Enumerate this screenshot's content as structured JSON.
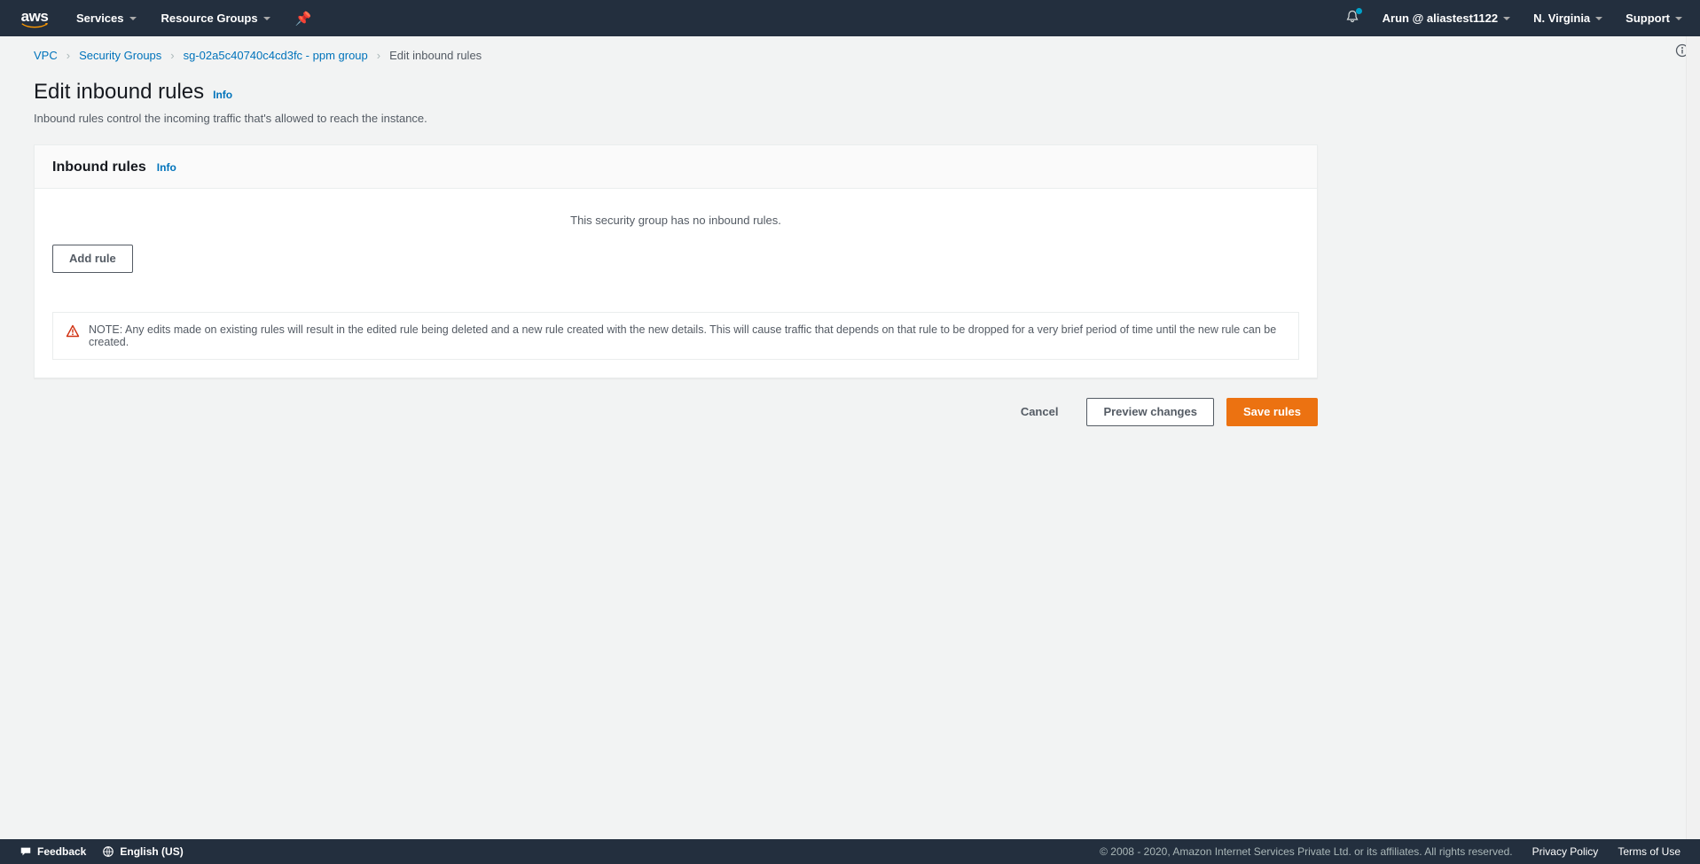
{
  "topnav": {
    "services": "Services",
    "resource_groups": "Resource Groups",
    "user": "Arun @ aliastest1122",
    "region": "N. Virginia",
    "support": "Support"
  },
  "breadcrumbs": {
    "items": [
      {
        "label": "VPC",
        "link": true
      },
      {
        "label": "Security Groups",
        "link": true
      },
      {
        "label": "sg-02a5c40740c4cd3fc - ppm group",
        "link": true
      },
      {
        "label": "Edit inbound rules",
        "link": false
      }
    ]
  },
  "page": {
    "title": "Edit inbound rules",
    "info_label": "Info",
    "description": "Inbound rules control the incoming traffic that's allowed to reach the instance."
  },
  "panel": {
    "title": "Inbound rules",
    "info_label": "Info",
    "empty_message": "This security group has no inbound rules.",
    "add_rule_label": "Add rule",
    "note_text": "NOTE: Any edits made on existing rules will result in the edited rule being deleted and a new rule created with the new details. This will cause traffic that depends on that rule to be dropped for a very brief period of time until the new rule can be created."
  },
  "actions": {
    "cancel": "Cancel",
    "preview": "Preview changes",
    "save": "Save rules"
  },
  "footer": {
    "feedback": "Feedback",
    "language": "English (US)",
    "copyright": "© 2008 - 2020, Amazon Internet Services Private Ltd. or its affiliates. All rights reserved.",
    "privacy": "Privacy Policy",
    "terms": "Terms of Use"
  }
}
